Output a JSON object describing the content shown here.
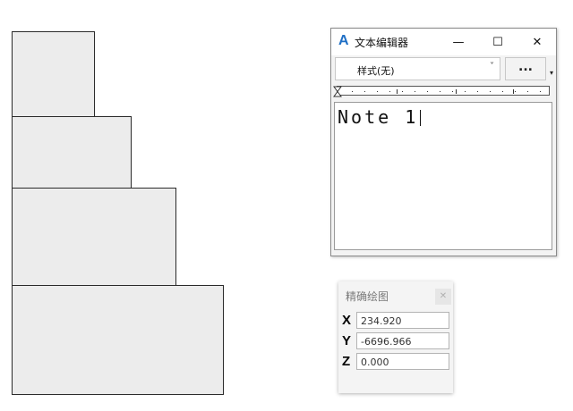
{
  "editor": {
    "title": "文本编辑器",
    "app_icon": "A",
    "window_buttons": {
      "minimize": "—",
      "maximize": "☐",
      "close": "✕"
    },
    "style_select": {
      "value": "样式(无)"
    },
    "more_label": "...",
    "overflow_glyph": "▾",
    "content": "Note 1"
  },
  "precise_panel": {
    "title": "精确绘图",
    "close_label": "✕",
    "coords": [
      {
        "axis": "X",
        "value": "234.920"
      },
      {
        "axis": "Y",
        "value": "-6696.966"
      },
      {
        "axis": "Z",
        "value": "0.000"
      }
    ]
  },
  "icons": {
    "app": "text-editor-icon",
    "ruler_marker": "hourglass-tab-icon",
    "dropdown": "chevron-down-icon"
  },
  "colors": {
    "block_fill": "#ececec",
    "accent": "#1f6fc5"
  }
}
